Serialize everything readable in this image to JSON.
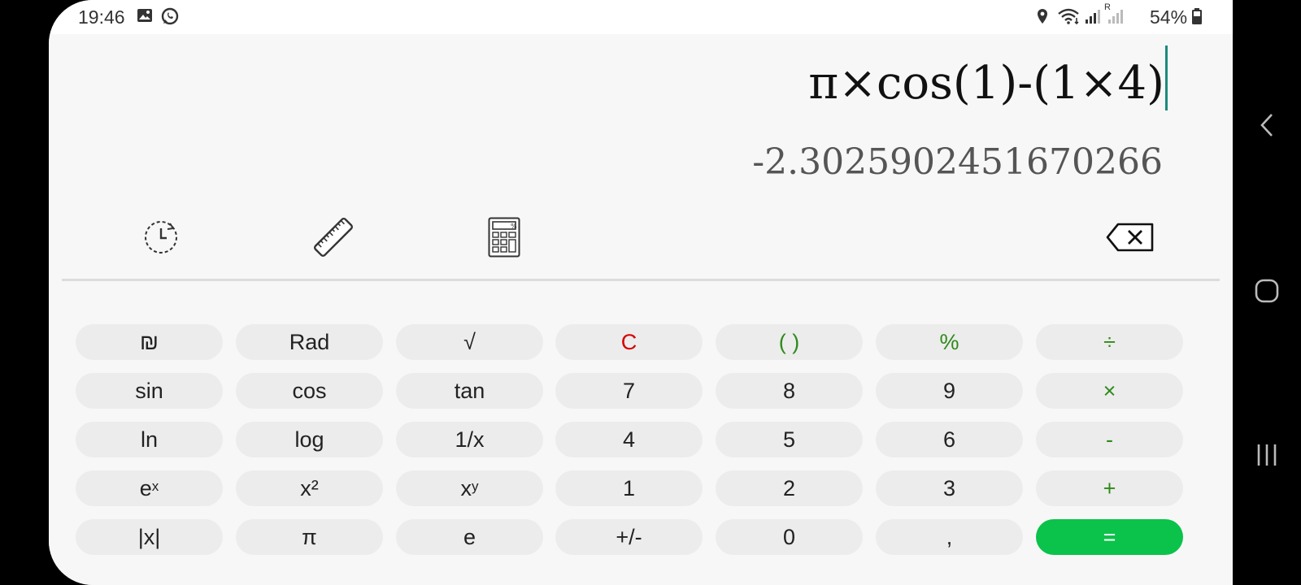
{
  "status_bar": {
    "time": "19:46",
    "left_icons": [
      "image-icon",
      "whatsapp-icon"
    ],
    "right_icons": [
      "location-icon",
      "wifi-icon",
      "signal-icon",
      "roaming-signal-icon"
    ],
    "roaming_label": "R",
    "battery_percent": "54%"
  },
  "display": {
    "expression": "π×cos(1)-(1×4)",
    "result": "-2.3025902451670266"
  },
  "toolbar": {
    "icons": [
      "history-icon",
      "unit-converter-icon",
      "calculator-icon",
      "backspace-icon"
    ]
  },
  "keypad": {
    "rows": [
      [
        {
          "label": "₪"
        },
        {
          "label": "Rad"
        },
        {
          "label": "√"
        },
        {
          "label": "C"
        },
        {
          "label": "( )"
        },
        {
          "label": "%"
        },
        {
          "label": "÷"
        }
      ],
      [
        {
          "label": "sin"
        },
        {
          "label": "cos"
        },
        {
          "label": "tan"
        },
        {
          "label": "7"
        },
        {
          "label": "8"
        },
        {
          "label": "9"
        },
        {
          "label": "×"
        }
      ],
      [
        {
          "label": "ln"
        },
        {
          "label": "log"
        },
        {
          "label": "1/x"
        },
        {
          "label": "4"
        },
        {
          "label": "5"
        },
        {
          "label": "6"
        },
        {
          "label": "-"
        }
      ],
      [
        {
          "label": "e",
          "sup": "x"
        },
        {
          "label": "x²"
        },
        {
          "label": "x",
          "sup": "y"
        },
        {
          "label": "1"
        },
        {
          "label": "2"
        },
        {
          "label": "3"
        },
        {
          "label": "+"
        }
      ],
      [
        {
          "label": "|x|"
        },
        {
          "label": "π"
        },
        {
          "label": "e"
        },
        {
          "label": "+/-"
        },
        {
          "label": "0"
        },
        {
          "label": ","
        },
        {
          "label": "="
        }
      ]
    ]
  },
  "colors": {
    "operator": "#2e8a1a",
    "clear": "#d40000",
    "equals_bg": "#0bc24a",
    "cursor": "#1c8a7e"
  },
  "nav_bar": {
    "icons": [
      "back-icon",
      "home-icon",
      "recent-apps-icon"
    ]
  }
}
